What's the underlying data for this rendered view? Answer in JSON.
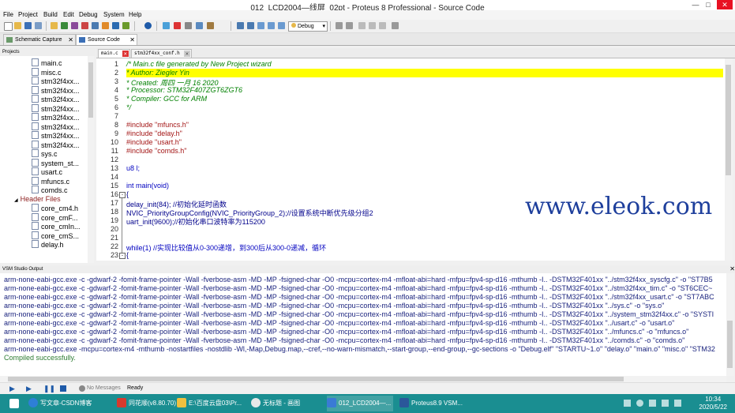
{
  "window": {
    "title": "012_LCD2004—线屏_02pt - Proteus 8 Professional - Source Code"
  },
  "menu": [
    "File",
    "Project",
    "Build",
    "Edit",
    "Debug",
    "System",
    "Help"
  ],
  "toolbar": {
    "config": "Debug"
  },
  "tabs": [
    {
      "label": "Schematic Capture"
    },
    {
      "label": "Source Code"
    }
  ],
  "projects": {
    "header": "Projects",
    "items": [
      {
        "label": "main.c",
        "kind": "file"
      },
      {
        "label": "misc.c",
        "kind": "file"
      },
      {
        "label": "stm32f4xx...",
        "kind": "file"
      },
      {
        "label": "stm32f4xx...",
        "kind": "file"
      },
      {
        "label": "stm32f4xx...",
        "kind": "file"
      },
      {
        "label": "stm32f4xx...",
        "kind": "file"
      },
      {
        "label": "stm32f4xx...",
        "kind": "file"
      },
      {
        "label": "stm32f4xx...",
        "kind": "file"
      },
      {
        "label": "stm32f4xx...",
        "kind": "file"
      },
      {
        "label": "stm32f4xx...",
        "kind": "file"
      },
      {
        "label": "sys.c",
        "kind": "file"
      },
      {
        "label": "system_st...",
        "kind": "file"
      },
      {
        "label": "usart.c",
        "kind": "file"
      },
      {
        "label": "mfuncs.c",
        "kind": "file"
      },
      {
        "label": "comds.c",
        "kind": "file"
      },
      {
        "label": "Header Files",
        "kind": "folder"
      },
      {
        "label": "core_cm4.h",
        "kind": "file"
      },
      {
        "label": "core_cmF...",
        "kind": "file"
      },
      {
        "label": "core_cmIn...",
        "kind": "file"
      },
      {
        "label": "core_cmS...",
        "kind": "file"
      },
      {
        "label": "delay.h",
        "kind": "file"
      }
    ]
  },
  "editor": {
    "tabs": [
      {
        "label": "main.c"
      },
      {
        "label": "stm32f4xx_conf.h"
      }
    ],
    "lines": [
      {
        "n": "1",
        "cls": "cm",
        "text": "/* Main.c file generated by New Project wizard"
      },
      {
        "n": "2",
        "cls": "cm",
        "text": " * Author:     Ziegler Yin"
      },
      {
        "n": "3",
        "cls": "cm",
        "text": " * Created:    周四 一月 16 2020"
      },
      {
        "n": "4",
        "cls": "cm",
        "text": " * Processor: STM32F407ZGT6ZGT6"
      },
      {
        "n": "5",
        "cls": "cm",
        "text": " * Compiler:  GCC for ARM"
      },
      {
        "n": "6",
        "cls": "cm",
        "text": " */"
      },
      {
        "n": "7",
        "cls": "",
        "text": ""
      },
      {
        "n": "8",
        "cls": "pp",
        "text": "#include \"mfuncs.h\""
      },
      {
        "n": "9",
        "cls": "pp",
        "text": "#include \"delay.h\""
      },
      {
        "n": "10",
        "cls": "pp",
        "text": "#include \"usart.h\""
      },
      {
        "n": "11",
        "cls": "pp",
        "text": "#include \"comds.h\""
      },
      {
        "n": "12",
        "cls": "",
        "text": ""
      },
      {
        "n": "13",
        "cls": "kw",
        "text": "u8 l;"
      },
      {
        "n": "14",
        "cls": "",
        "text": ""
      },
      {
        "n": "15",
        "cls": "kw",
        "text": "int main(void)"
      },
      {
        "n": "16",
        "cls": "fn",
        "text": "{"
      },
      {
        "n": "17",
        "cls": "fn",
        "text": "    delay_init(84);  //初始化延时函数"
      },
      {
        "n": "18",
        "cls": "fn",
        "text": "    NVIC_PriorityGroupConfig(NVIC_PriorityGroup_2);//设置系统中断优先级分组2"
      },
      {
        "n": "19",
        "cls": "fn",
        "text": "    uart_init(9600);//初始化串口波特率为115200"
      },
      {
        "n": "20",
        "cls": "",
        "text": ""
      },
      {
        "n": "21",
        "cls": "",
        "text": ""
      },
      {
        "n": "22",
        "cls": "kw",
        "text": "    while(1) //实现比较值从0-300递增，到300后从300-0递减，循环"
      },
      {
        "n": "23",
        "cls": "fn",
        "text": "    {"
      }
    ],
    "watermark": "www.eleok.com"
  },
  "output": {
    "header": "VSM Studio Output",
    "lines": [
      "arm-none-eabi-gcc.exe -c -gdwarf-2 -fomit-frame-pointer -Wall -fverbose-asm -MD -MP -fsigned-char -O0 -mcpu=cortex-m4 -mfloat-abi=hard -mfpu=fpv4-sp-d16 -mthumb -I.. -DSTM32F401xx  \"../stm32f4xx_syscfg.c\" -o \"ST7B5",
      "arm-none-eabi-gcc.exe -c -gdwarf-2 -fomit-frame-pointer -Wall -fverbose-asm -MD -MP -fsigned-char -O0 -mcpu=cortex-m4 -mfloat-abi=hard -mfpu=fpv4-sp-d16 -mthumb -I.. -DSTM32F401xx  \"../stm32f4xx_tim.c\" -o \"ST6CEC~",
      "arm-none-eabi-gcc.exe -c -gdwarf-2 -fomit-frame-pointer -Wall -fverbose-asm -MD -MP -fsigned-char -O0 -mcpu=cortex-m4 -mfloat-abi=hard -mfpu=fpv4-sp-d16 -mthumb -I.. -DSTM32F401xx  \"../stm32f4xx_usart.c\" -o \"ST7ABC",
      "arm-none-eabi-gcc.exe -c -gdwarf-2 -fomit-frame-pointer -Wall -fverbose-asm -MD -MP -fsigned-char -O0 -mcpu=cortex-m4 -mfloat-abi=hard -mfpu=fpv4-sp-d16 -mthumb -I.. -DSTM32F401xx  \"../sys.c\" -o \"sys.o\"",
      "arm-none-eabi-gcc.exe -c -gdwarf-2 -fomit-frame-pointer -Wall -fverbose-asm -MD -MP -fsigned-char -O0 -mcpu=cortex-m4 -mfloat-abi=hard -mfpu=fpv4-sp-d16 -mthumb -I.. -DSTM32F401xx  \"../system_stm32f4xx.c\" -o \"SYSTI",
      "arm-none-eabi-gcc.exe -c -gdwarf-2 -fomit-frame-pointer -Wall -fverbose-asm -MD -MP -fsigned-char -O0 -mcpu=cortex-m4 -mfloat-abi=hard -mfpu=fpv4-sp-d16 -mthumb -I.. -DSTM32F401xx  \"../usart.c\" -o \"usart.o\"",
      "arm-none-eabi-gcc.exe -c -gdwarf-2 -fomit-frame-pointer -Wall -fverbose-asm -MD -MP -fsigned-char -O0 -mcpu=cortex-m4 -mfloat-abi=hard -mfpu=fpv4-sp-d16 -mthumb -I.. -DSTM32F401xx  \"../mfuncs.c\" -o \"mfuncs.o\"",
      "arm-none-eabi-gcc.exe -c -gdwarf-2 -fomit-frame-pointer -Wall -fverbose-asm -MD -MP -fsigned-char -O0 -mcpu=cortex-m4 -mfloat-abi=hard -mfpu=fpv4-sp-d16 -mthumb -I.. -DSTM32F401xx  \"../comds.c\" -o \"comds.o\"",
      "arm-none-eabi-gcc.exe -mcpu=cortex-m4 -mthumb -nostartfiles -nostdlib  -Wl,-Map,Debug.map,--cref,--no-warn-mismatch,--start-group,--end-group,--gc-sections -o \"Debug.elf\" \"STARTU~1.o\" \"delay.o\" \"main.o\" \"misc.o\" \"STM32"
    ],
    "success": "Compiled successfully."
  },
  "status": {
    "messages": "No Messages",
    "state": "Ready"
  },
  "taskbar": {
    "items": [
      {
        "label": "写文章-CSDN博客",
        "color": "#2e7fd6"
      },
      {
        "label": "同花顺(v8.80.70) -...",
        "color": "#d63a2e"
      },
      {
        "label": "E:\\百度云盘03\\Pr...",
        "color": "#f0c040"
      },
      {
        "label": "无标题 - 画图",
        "color": "#e8e8e8"
      },
      {
        "label": "012_LCD2004—...",
        "color": "#3a7bd5"
      },
      {
        "label": "Proteus8.9 VSM...",
        "color": "#2b579a"
      }
    ],
    "time": "10:34",
    "date": "2020/5/22"
  }
}
